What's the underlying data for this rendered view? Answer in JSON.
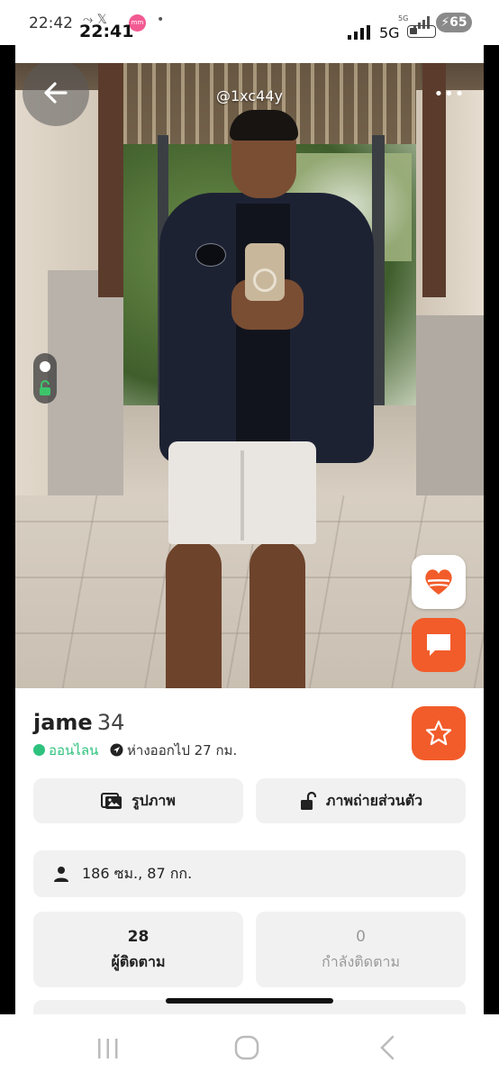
{
  "outer_status": {
    "time": "22:42",
    "notif_icons": "⤳ 𝕏",
    "app_badge": "mm",
    "dot": "•",
    "network_small": "5G",
    "battery": "65"
  },
  "inner_status": {
    "time": "22:41",
    "network": "5G"
  },
  "photo": {
    "handle": "@1xc44y",
    "more": "•••"
  },
  "profile": {
    "name": "jame",
    "age": "34",
    "status": "ออนไลน",
    "distance": "ห่างออกไป 27 กม."
  },
  "tabs": {
    "photos": "รูปภาพ",
    "private": "ภาพถ่ายส่วนตัว"
  },
  "stats": {
    "body": "186 ซม., 87 กก."
  },
  "follow": {
    "followers_count": "28",
    "followers_label": "ผู้ติดตาม",
    "following_count": "0",
    "following_label": "กำลังติดตาม"
  },
  "colors": {
    "accent": "#f25c2a",
    "online": "#2ec27e"
  },
  "icons": [
    "back-arrow-icon",
    "more-icon",
    "lock-open-icon",
    "heart-icon",
    "chat-icon",
    "star-icon",
    "location-arrow-icon",
    "photos-icon",
    "padlock-icon",
    "person-icon",
    "recent-apps-icon",
    "home-icon",
    "back-icon"
  ]
}
